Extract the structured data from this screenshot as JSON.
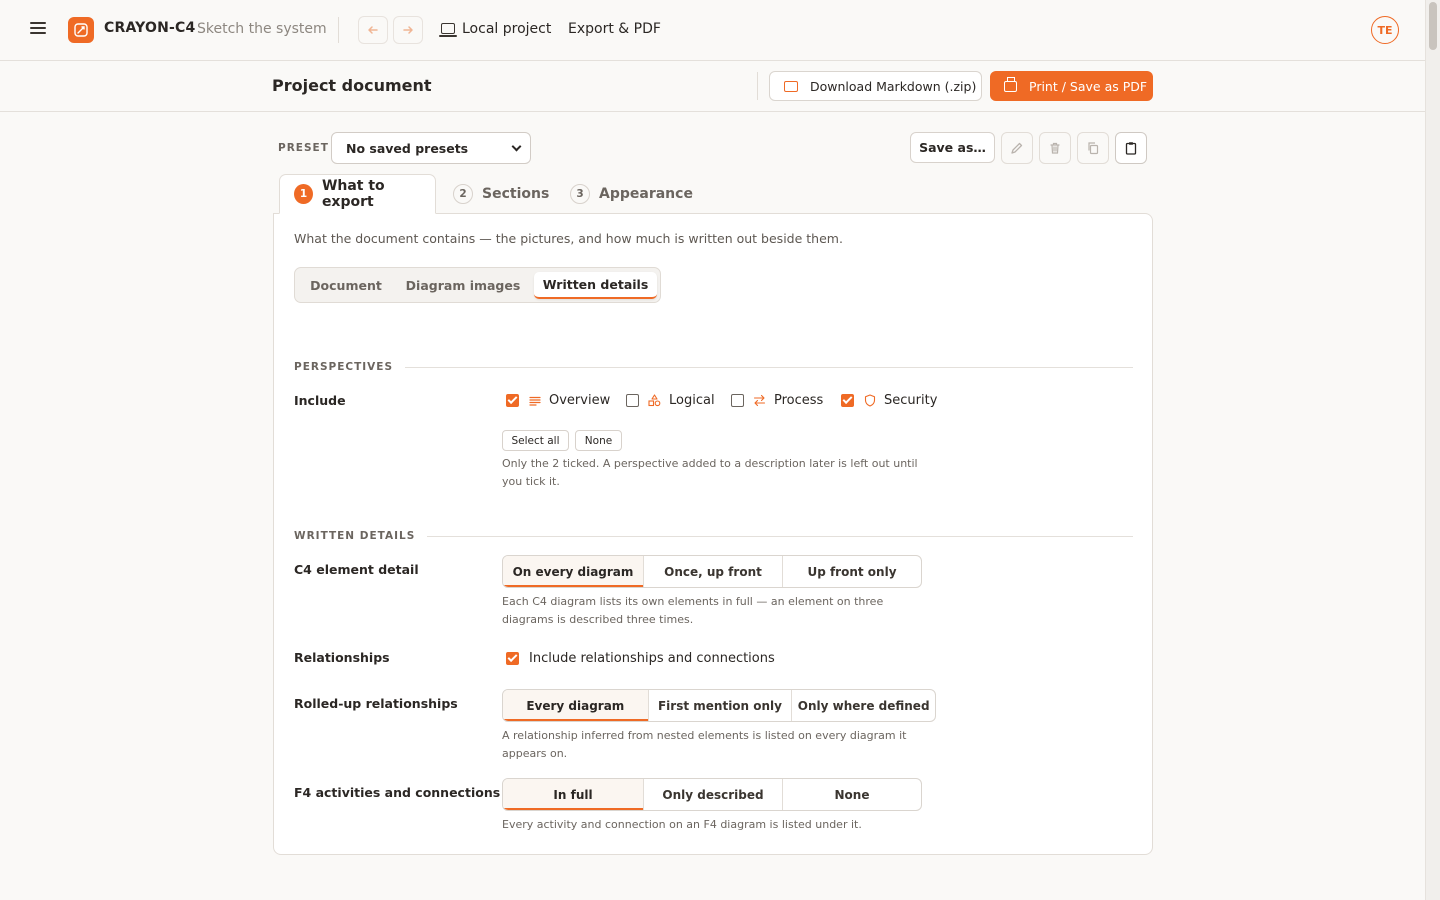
{
  "app": {
    "name": "CRAYON-C4",
    "tagline": "Sketch the system",
    "nav_links": [
      "Local project",
      "Export & PDF"
    ],
    "avatar_initials": "TE",
    "accent_color": "#ef6a25"
  },
  "doc_header": {
    "title": "Project document",
    "download_label": "Download Markdown (.zip)",
    "print_label": "Print / Save as PDF"
  },
  "preset": {
    "label": "PRESET",
    "selected": "No saved presets",
    "save_as_label": "Save as…"
  },
  "steps": [
    {
      "num": "1",
      "label": "What to export",
      "active": true
    },
    {
      "num": "2",
      "label": "Sections",
      "active": false
    },
    {
      "num": "3",
      "label": "Appearance",
      "active": false
    }
  ],
  "panel": {
    "intro": "What the document contains — the pictures, and how much is written out beside them.",
    "subtabs": [
      "Document",
      "Diagram images",
      "Written details"
    ],
    "active_subtab": "Written details"
  },
  "perspectives": {
    "section_title": "PERSPECTIVES",
    "include_label": "Include",
    "items": [
      {
        "label": "Overview",
        "checked": true,
        "icon": "lines-icon"
      },
      {
        "label": "Logical",
        "checked": false,
        "icon": "shapes-icon"
      },
      {
        "label": "Process",
        "checked": false,
        "icon": "swap-arrows-icon"
      },
      {
        "label": "Security",
        "checked": true,
        "icon": "shield-icon"
      }
    ],
    "select_all_label": "Select all",
    "none_label": "None",
    "help_line1": "Only the 2 ticked. A perspective added to a description later is left out until",
    "help_line2": "you tick it."
  },
  "written_details": {
    "section_title": "WRITTEN DETAILS",
    "c4": {
      "label": "C4 element detail",
      "options": [
        "On every diagram",
        "Once, up front",
        "Up front only"
      ],
      "selected": "On every diagram",
      "help_line1": "Each C4 diagram lists its own elements in full — an element on three",
      "help_line2": "diagrams is described three times."
    },
    "relationships": {
      "label": "Relationships",
      "checkbox_label": "Include relationships and connections",
      "checked": true
    },
    "rolled_up": {
      "label": "Rolled-up relationships",
      "options": [
        "Every diagram",
        "First mention only",
        "Only where defined"
      ],
      "selected": "Every diagram",
      "help_line1": "A relationship inferred from nested elements is listed on every diagram it",
      "help_line2": "appears on."
    },
    "f4": {
      "label": "F4 activities and connections",
      "options": [
        "In full",
        "Only described",
        "None"
      ],
      "selected": "In full",
      "help": "Every activity and connection on an F4 diagram is listed under it."
    }
  }
}
